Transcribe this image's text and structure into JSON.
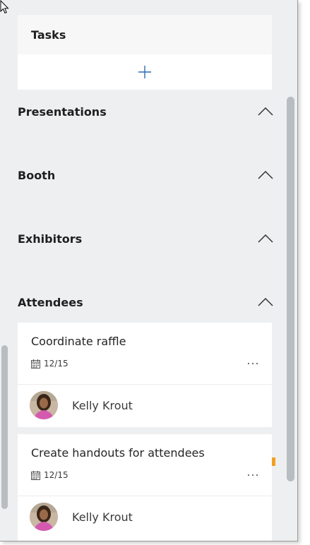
{
  "colors": {
    "panel_bg": "#eeeff1",
    "card_bg": "#ffffff",
    "header_bg": "#f7f7f8",
    "accent_blue": "#2b6cb0",
    "status_orange": "#f0a020",
    "scrollbar": "#b8bdc1"
  },
  "tasks_card": {
    "title": "Tasks",
    "add_icon": "plus-icon"
  },
  "sections": [
    {
      "title": "Presentations",
      "icon": "chevron-up-icon"
    },
    {
      "title": "Booth",
      "icon": "chevron-up-icon"
    },
    {
      "title": "Exhibitors",
      "icon": "chevron-up-icon"
    },
    {
      "title": "Attendees",
      "icon": "chevron-up-icon"
    }
  ],
  "task_cards": [
    {
      "title": "Coordinate raffle",
      "due_date": "12/15",
      "due_icon": "calendar-icon",
      "more_icon": "more-options-icon",
      "assignee": "Kelly Krout"
    },
    {
      "title": "Create handouts for attendees",
      "due_date": "12/15",
      "due_icon": "calendar-icon",
      "more_icon": "more-options-icon",
      "assignee": "Kelly Krout"
    }
  ]
}
